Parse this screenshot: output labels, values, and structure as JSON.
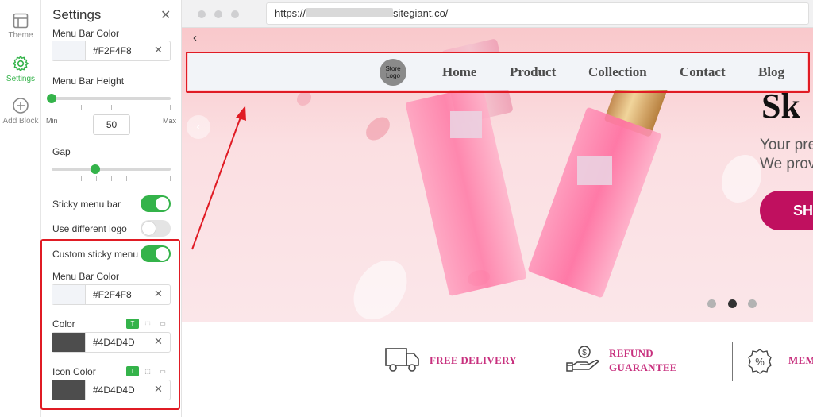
{
  "rail": {
    "items": [
      {
        "label": "Theme",
        "icon": "layout-icon"
      },
      {
        "label": "Settings",
        "icon": "gear-icon"
      },
      {
        "label": "Add Block",
        "icon": "plus-circle-icon"
      }
    ]
  },
  "panel": {
    "title": "Settings",
    "menu_bar_color": {
      "label": "Menu Bar Color",
      "value": "#F2F4F8"
    },
    "menu_bar_height": {
      "label": "Menu Bar Height",
      "value": "50",
      "min_label": "Min",
      "max_label": "Max"
    },
    "gap": {
      "label": "Gap",
      "level": 0.37
    },
    "sticky_menu_bar": {
      "label": "Sticky menu bar",
      "on": true
    },
    "use_different_logo": {
      "label": "Use different logo",
      "on": false
    },
    "custom_sticky_menu": {
      "label": "Custom sticky menu",
      "on": true
    },
    "sticky_menu_bar_color": {
      "label": "Menu Bar Color",
      "value": "#F2F4F8"
    },
    "color": {
      "label": "Color",
      "value": "#4D4D4D",
      "mode_text": "T"
    },
    "icon_color": {
      "label": "Icon Color",
      "value": "#4D4D4D",
      "mode_text": "T"
    }
  },
  "browser": {
    "url_prefix": "https://",
    "url_suffix": "sitegiant.co/"
  },
  "site": {
    "logo_text_1": "Store",
    "logo_text_2": "Logo",
    "nav": [
      "Home",
      "Product",
      "Collection",
      "Contact",
      "Blog"
    ],
    "hero_title": "Sk",
    "hero_line_1": "Your pre",
    "hero_line_2": "We prov",
    "hero_button": "SH",
    "features": {
      "delivery": "FREE DELIVERY",
      "refund_1": "REFUND",
      "refund_2": "GUARANTEE",
      "member": "MEM"
    }
  },
  "colors": {
    "accent": "#34b34a",
    "highlight": "#e01b24",
    "brand": "#c0105f",
    "menu_bg": "#F2F4F8",
    "menu_text": "#4D4D4D"
  }
}
